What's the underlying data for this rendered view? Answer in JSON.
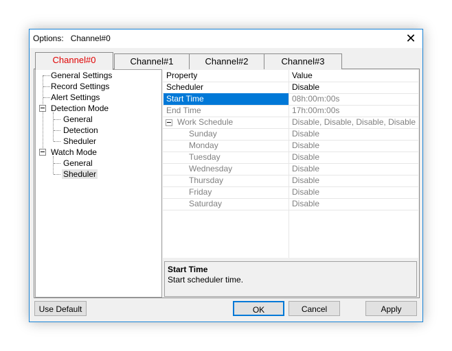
{
  "window": {
    "title": "Options:   Channel#0",
    "close_glyph": "✕"
  },
  "tabs": [
    {
      "label": "Channel#0",
      "active": true,
      "color": "#e00000"
    },
    {
      "label": "Channel#1",
      "active": false
    },
    {
      "label": "Channel#2",
      "active": false
    },
    {
      "label": "Channel#3",
      "active": false
    }
  ],
  "tree": {
    "items": [
      {
        "label": "General Settings"
      },
      {
        "label": "Record Settings"
      },
      {
        "label": "Alert Settings"
      },
      {
        "label": "Detection Mode",
        "expanded": true
      },
      {
        "label": "General"
      },
      {
        "label": "Detection"
      },
      {
        "label": "Sheduler"
      },
      {
        "label": "Watch Mode",
        "expanded": true
      },
      {
        "label": "General"
      },
      {
        "label": "Sheduler",
        "selected": true
      }
    ]
  },
  "grid": {
    "header": {
      "property": "Property",
      "value": "Value"
    },
    "rows": [
      {
        "property": "Scheduler",
        "value": "Disable"
      },
      {
        "property": "Start Time",
        "value": "08h:00m:00s",
        "selected": true
      },
      {
        "property": "End Time",
        "value": "17h:00m:00s"
      },
      {
        "property": "Work Schedule",
        "value": "Disable, Disable, Disable, Disable, ...",
        "group": true
      },
      {
        "property": "Sunday",
        "value": "Disable"
      },
      {
        "property": "Monday",
        "value": "Disable"
      },
      {
        "property": "Tuesday",
        "value": "Disable"
      },
      {
        "property": "Wednesday",
        "value": "Disable"
      },
      {
        "property": "Thursday",
        "value": "Disable"
      },
      {
        "property": "Friday",
        "value": "Disable"
      },
      {
        "property": "Saturday",
        "value": "Disable"
      }
    ],
    "accent": "#0078d7"
  },
  "description": {
    "title": "Start Time",
    "text": "Start scheduler time."
  },
  "buttons": {
    "use_default": "Use Default",
    "ok": "OK",
    "cancel": "Cancel",
    "apply": "Apply"
  }
}
